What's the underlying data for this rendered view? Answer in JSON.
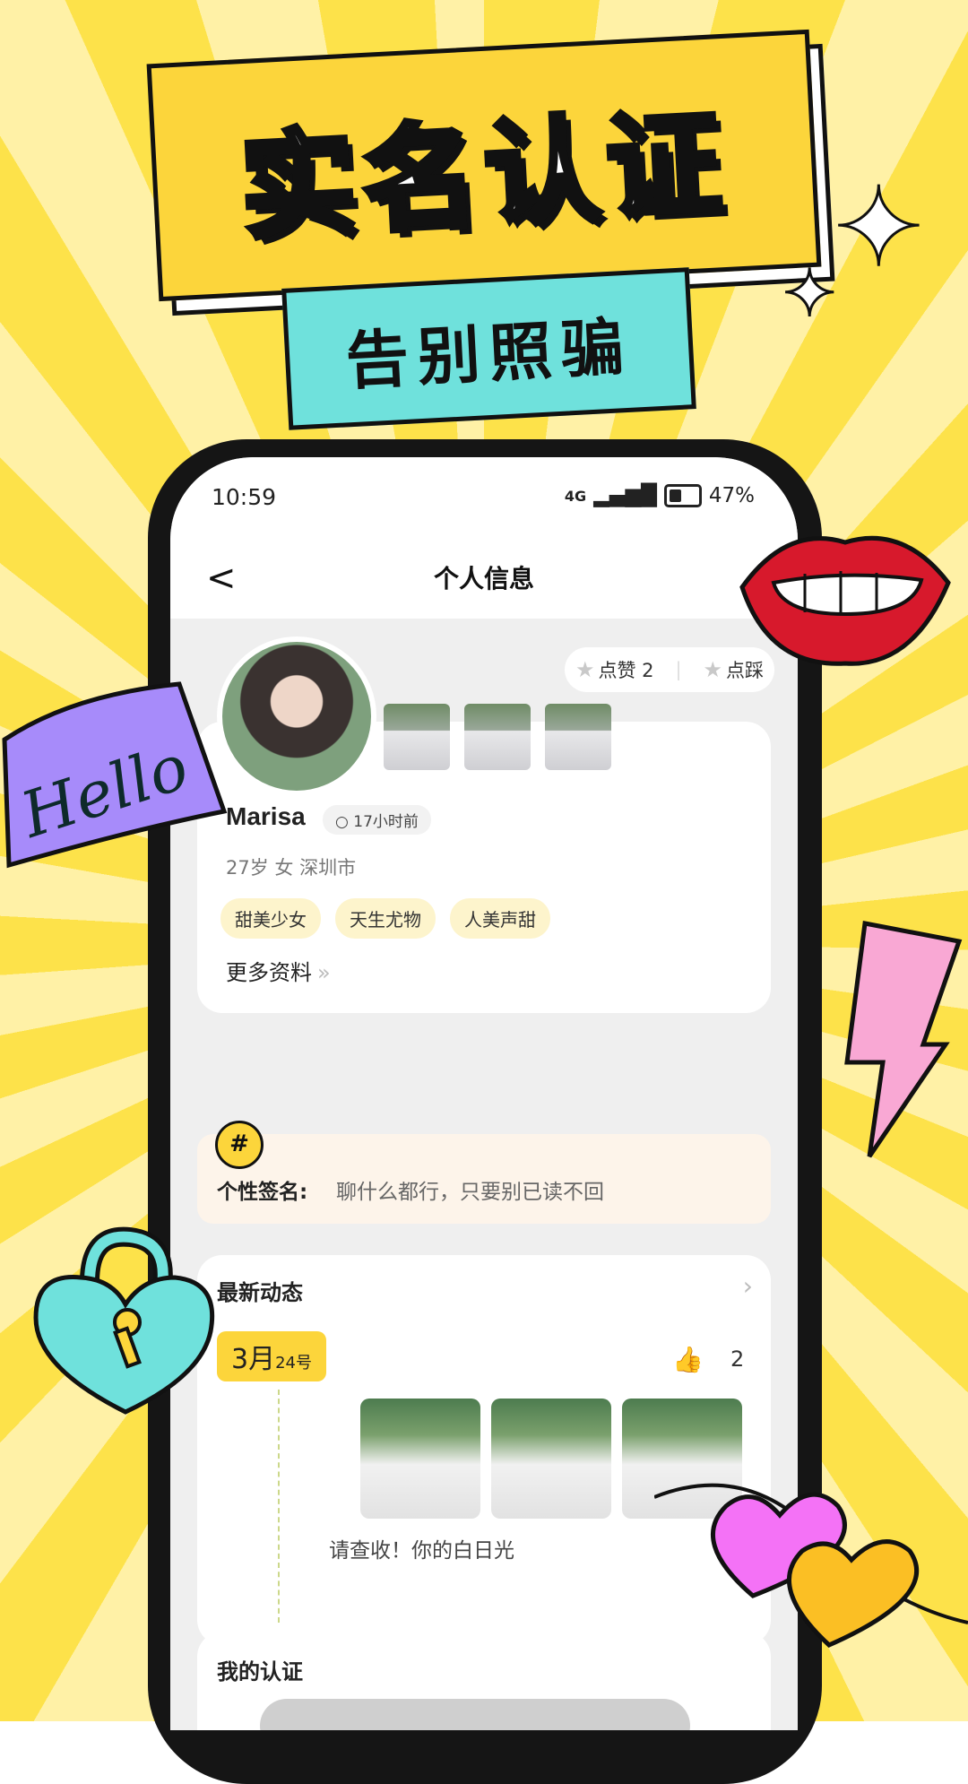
{
  "headline": "实名认证",
  "subheadline": "告别照骗",
  "status_bar": {
    "time": "10:59",
    "network": "4G",
    "battery": "47%"
  },
  "nav": {
    "back": "<",
    "title": "个人信息",
    "more": "⋯"
  },
  "profile": {
    "name": "Marisa",
    "online": "17小时前",
    "meta": "27岁  女  深圳市",
    "tags": [
      "甜美少女",
      "天生尤物",
      "人美声甜"
    ],
    "more_info": "更多资料",
    "likes_label": "点赞 2",
    "dislike_label": "点踩"
  },
  "signature": {
    "label": "个性签名:",
    "text": "聊什么都行，只要别已读不回"
  },
  "moments": {
    "title": "最新动态",
    "date_month": "3月",
    "date_day": "24号",
    "like_count": "2",
    "caption": "请查收！你的白日光"
  },
  "certification": {
    "title": "我的认证"
  },
  "sticker_hello": "Hello"
}
